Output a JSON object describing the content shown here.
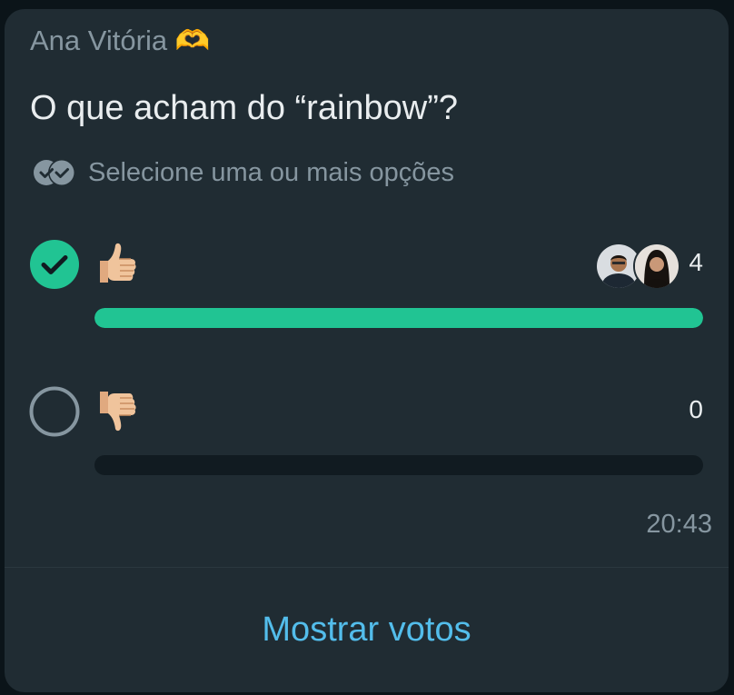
{
  "poll": {
    "sender": "Ana Vitória 🫶",
    "question": "O que acham do “rainbow”?",
    "hint": "Selecione uma ou mais opções",
    "options": [
      {
        "emoji": "thumbs-up",
        "votes": "4",
        "selected": true,
        "fill_fraction": 1.0
      },
      {
        "emoji": "thumbs-down",
        "votes": "0",
        "selected": false,
        "fill_fraction": 0.0
      }
    ],
    "time": "20:43",
    "show_votes_label": "Mostrar votos"
  },
  "colors": {
    "accent_green": "#21c493",
    "link_blue": "#53bdeb",
    "bubble_bg": "#202c33",
    "track_bg": "#111b21",
    "muted_text": "#8696a0",
    "primary_text": "#e9edef"
  }
}
